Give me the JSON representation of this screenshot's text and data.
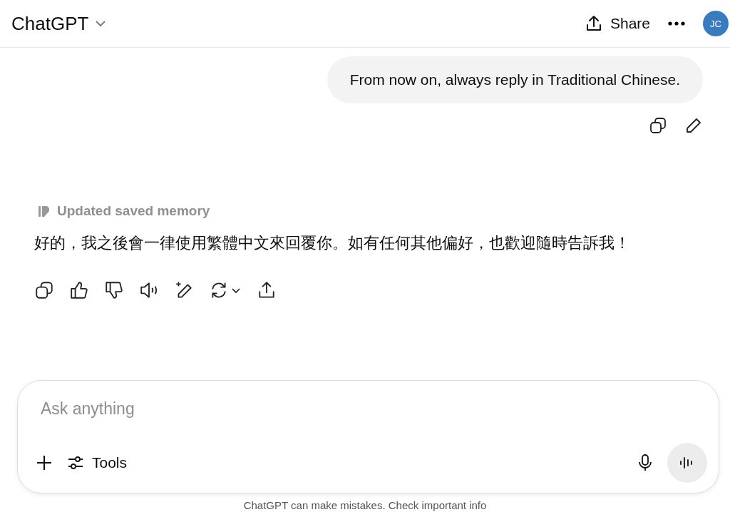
{
  "header": {
    "title": "ChatGPT",
    "share_label": "Share",
    "avatar": "JC"
  },
  "user_message": {
    "text": "From now on, always reply in Traditional Chinese."
  },
  "assistant_message": {
    "memory_note": "Updated saved memory",
    "text": "好的，我之後會一律使用繁體中文來回覆你。如有任何其他偏好，也歡迎隨時告訴我！"
  },
  "composer": {
    "placeholder": "Ask anything",
    "tools_label": "Tools"
  },
  "footer": {
    "text": "ChatGPT can make mistakes. Check important info"
  }
}
